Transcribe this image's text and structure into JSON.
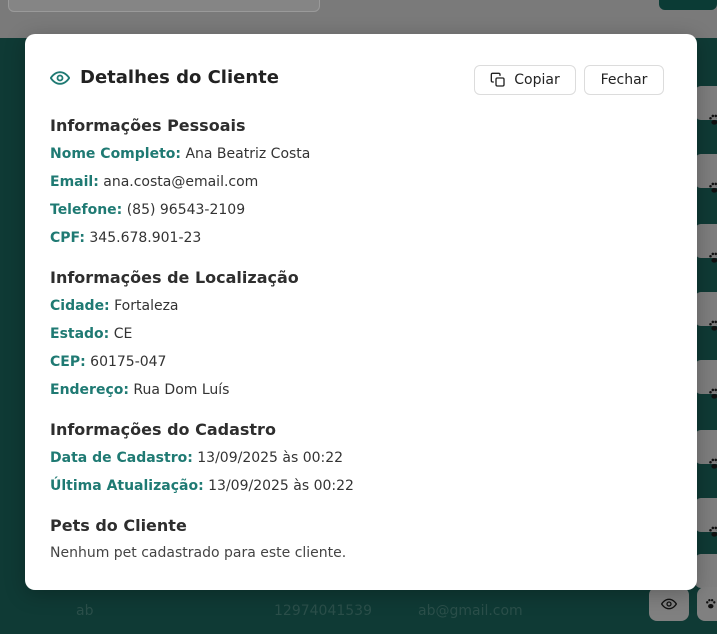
{
  "modal": {
    "title": "Detalhes do Cliente",
    "copy_label": "Copiar",
    "close_label": "Fechar",
    "sections": {
      "personal": {
        "title": "Informações Pessoais",
        "fields": [
          {
            "label": "Nome Completo:",
            "value": "Ana Beatriz Costa"
          },
          {
            "label": "Email:",
            "value": "ana.costa@email.com"
          },
          {
            "label": "Telefone:",
            "value": "(85) 96543-2109"
          },
          {
            "label": "CPF:",
            "value": "345.678.901-23"
          }
        ]
      },
      "location": {
        "title": "Informações de Localização",
        "fields": [
          {
            "label": "Cidade:",
            "value": "Fortaleza"
          },
          {
            "label": "Estado:",
            "value": "CE"
          },
          {
            "label": "CEP:",
            "value": "60175-047"
          },
          {
            "label": "Endereço:",
            "value": "Rua Dom Luís"
          }
        ]
      },
      "registration": {
        "title": "Informações do Cadastro",
        "fields": [
          {
            "label": "Data de Cadastro:",
            "value": "13/09/2025 às 00:22"
          },
          {
            "label": "Última Atualização:",
            "value": "13/09/2025 às 00:22"
          }
        ]
      },
      "pets": {
        "title": "Pets do Cliente",
        "empty_message": "Nenhum pet cadastrado para este cliente."
      }
    }
  },
  "background_table": {
    "last_row": {
      "name": "ab",
      "phone": "12974041539",
      "email": "ab@gmail.com"
    }
  },
  "colors": {
    "accent": "#1f7a73",
    "table_bg": "#0f3a35"
  },
  "icons": [
    "eye-icon",
    "copy-icon",
    "paw-icon"
  ]
}
